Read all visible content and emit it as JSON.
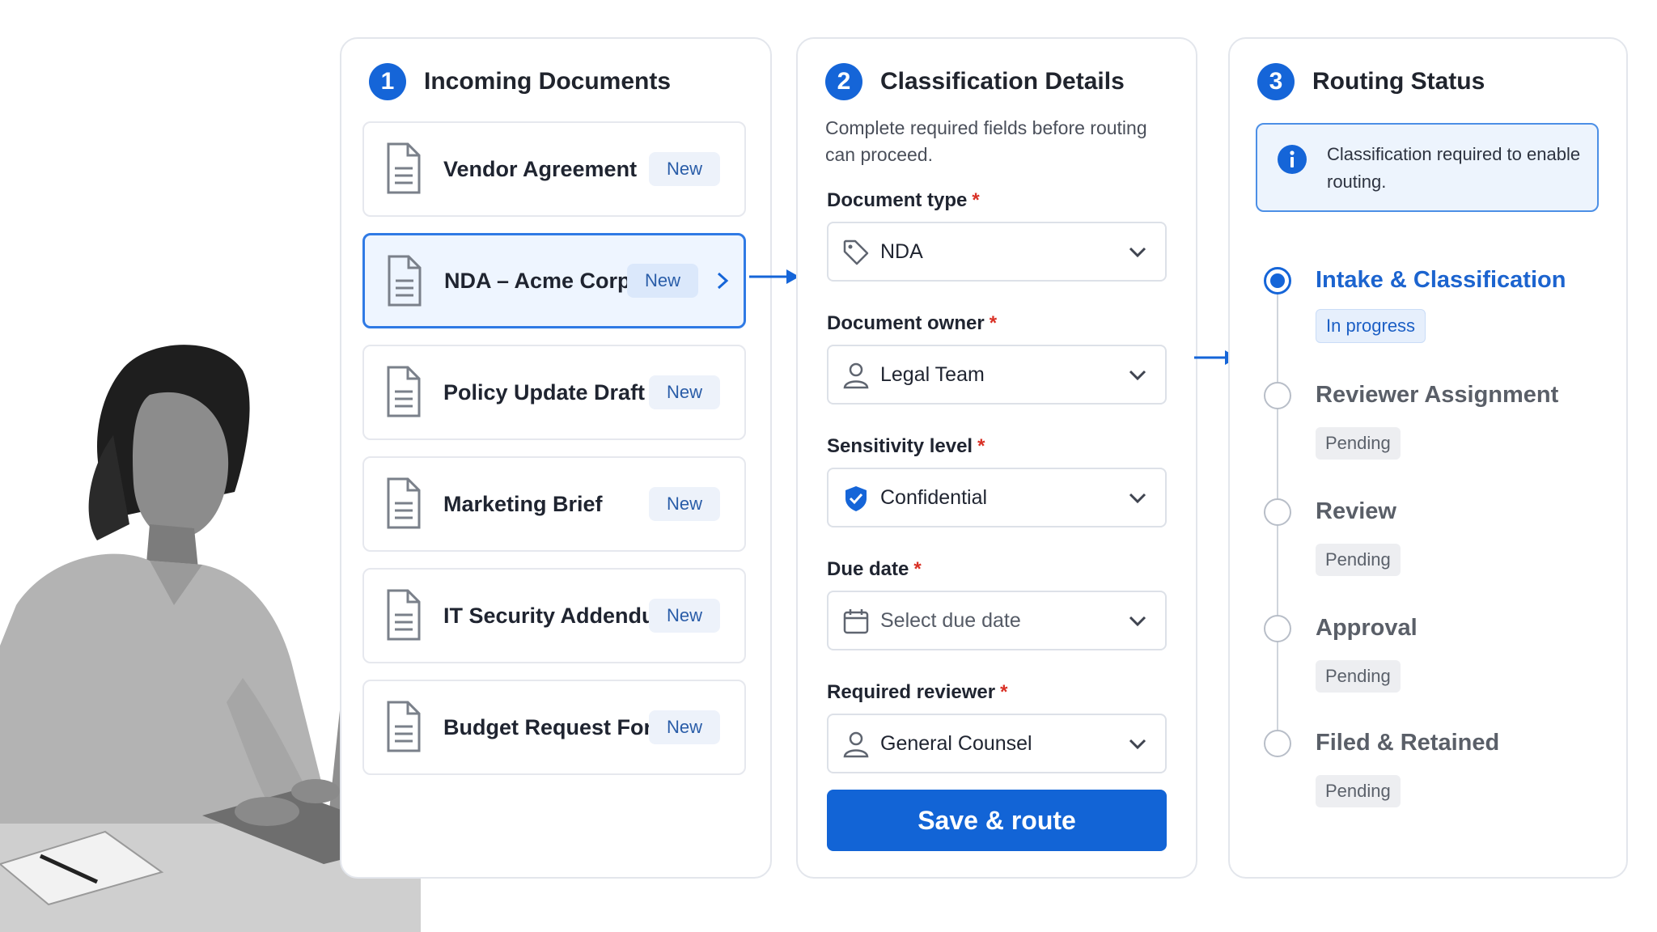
{
  "incoming": {
    "step": "1",
    "title": "Incoming Documents",
    "documents": [
      {
        "name": "Vendor Agreement",
        "badge": "New"
      },
      {
        "name": "NDA – Acme Corp",
        "badge": "New"
      },
      {
        "name": "Policy Update Draft",
        "badge": "New"
      },
      {
        "name": "Marketing Brief",
        "badge": "New"
      },
      {
        "name": "IT Security Addendum",
        "badge": "New"
      },
      {
        "name": "Budget Request Form",
        "badge": "New"
      }
    ]
  },
  "classification": {
    "step": "2",
    "title": "Classification Details",
    "subtitle": "Complete required fields before routing can proceed.",
    "required_marker": "*",
    "fields": [
      {
        "label": "Document type",
        "value": "NDA",
        "icon": "tag-icon"
      },
      {
        "label": "Document owner",
        "value": "Legal Team",
        "icon": "user-icon"
      },
      {
        "label": "Sensitivity level",
        "value": "Confidential",
        "icon": "shield-check-icon"
      },
      {
        "label": "Due date",
        "value": "Select due date",
        "icon": "calendar-icon"
      },
      {
        "label": "Required reviewer",
        "value": "General Counsel",
        "icon": "user-icon"
      }
    ],
    "submit_label": "Save & route"
  },
  "routing": {
    "step": "3",
    "title": "Routing Status",
    "notice": "Classification required to enable routing.",
    "stages": [
      {
        "title": "Intake & Classification",
        "status": "In progress"
      },
      {
        "title": "Reviewer Assignment",
        "status": "Pending"
      },
      {
        "title": "Review",
        "status": "Pending"
      },
      {
        "title": "Approval",
        "status": "Pending"
      },
      {
        "title": "Filed & Retained",
        "status": "Pending"
      }
    ]
  },
  "colors": {
    "accent": "#1565d8",
    "required": "#d93025"
  }
}
